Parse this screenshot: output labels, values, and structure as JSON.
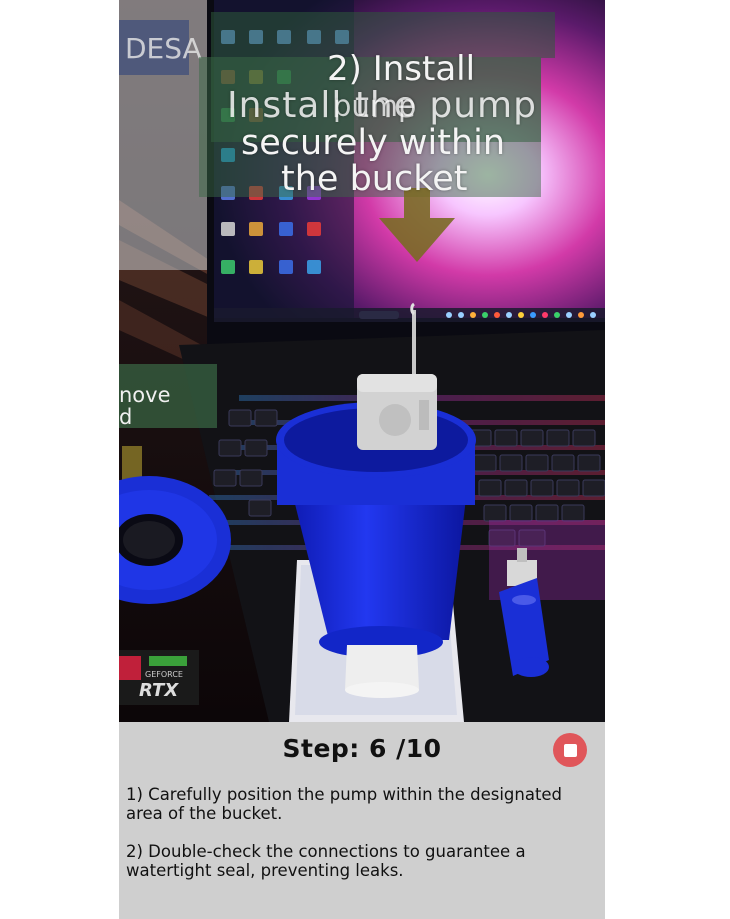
{
  "ar_overlay": {
    "step_heading": "2) Install",
    "overlap_line_1": "Install the pump",
    "overlap_line_1b": "pump",
    "overlap_line_2": "securely within",
    "overlap_line_3": "the bucket",
    "left_label": "nove\nd"
  },
  "panel": {
    "step_label": "Step: 6 /10",
    "instructions": [
      "1) Carefully position the pump within the designated area of the bucket.",
      "2) Double-check the connections to guarantee a watertight seal, preventing leaks."
    ]
  },
  "background": {
    "laptop_brand": "RTX",
    "laptop_brand_prefix": "GEFORCE",
    "bottle_label": "DESA"
  },
  "colors": {
    "bucket_blue": "#1a2fd6",
    "arrow_olive": "#7a6a25",
    "label_panel_green": "#2e5a3a",
    "panel_bg": "#cfcfcf",
    "stop_red": "#e0565a"
  }
}
